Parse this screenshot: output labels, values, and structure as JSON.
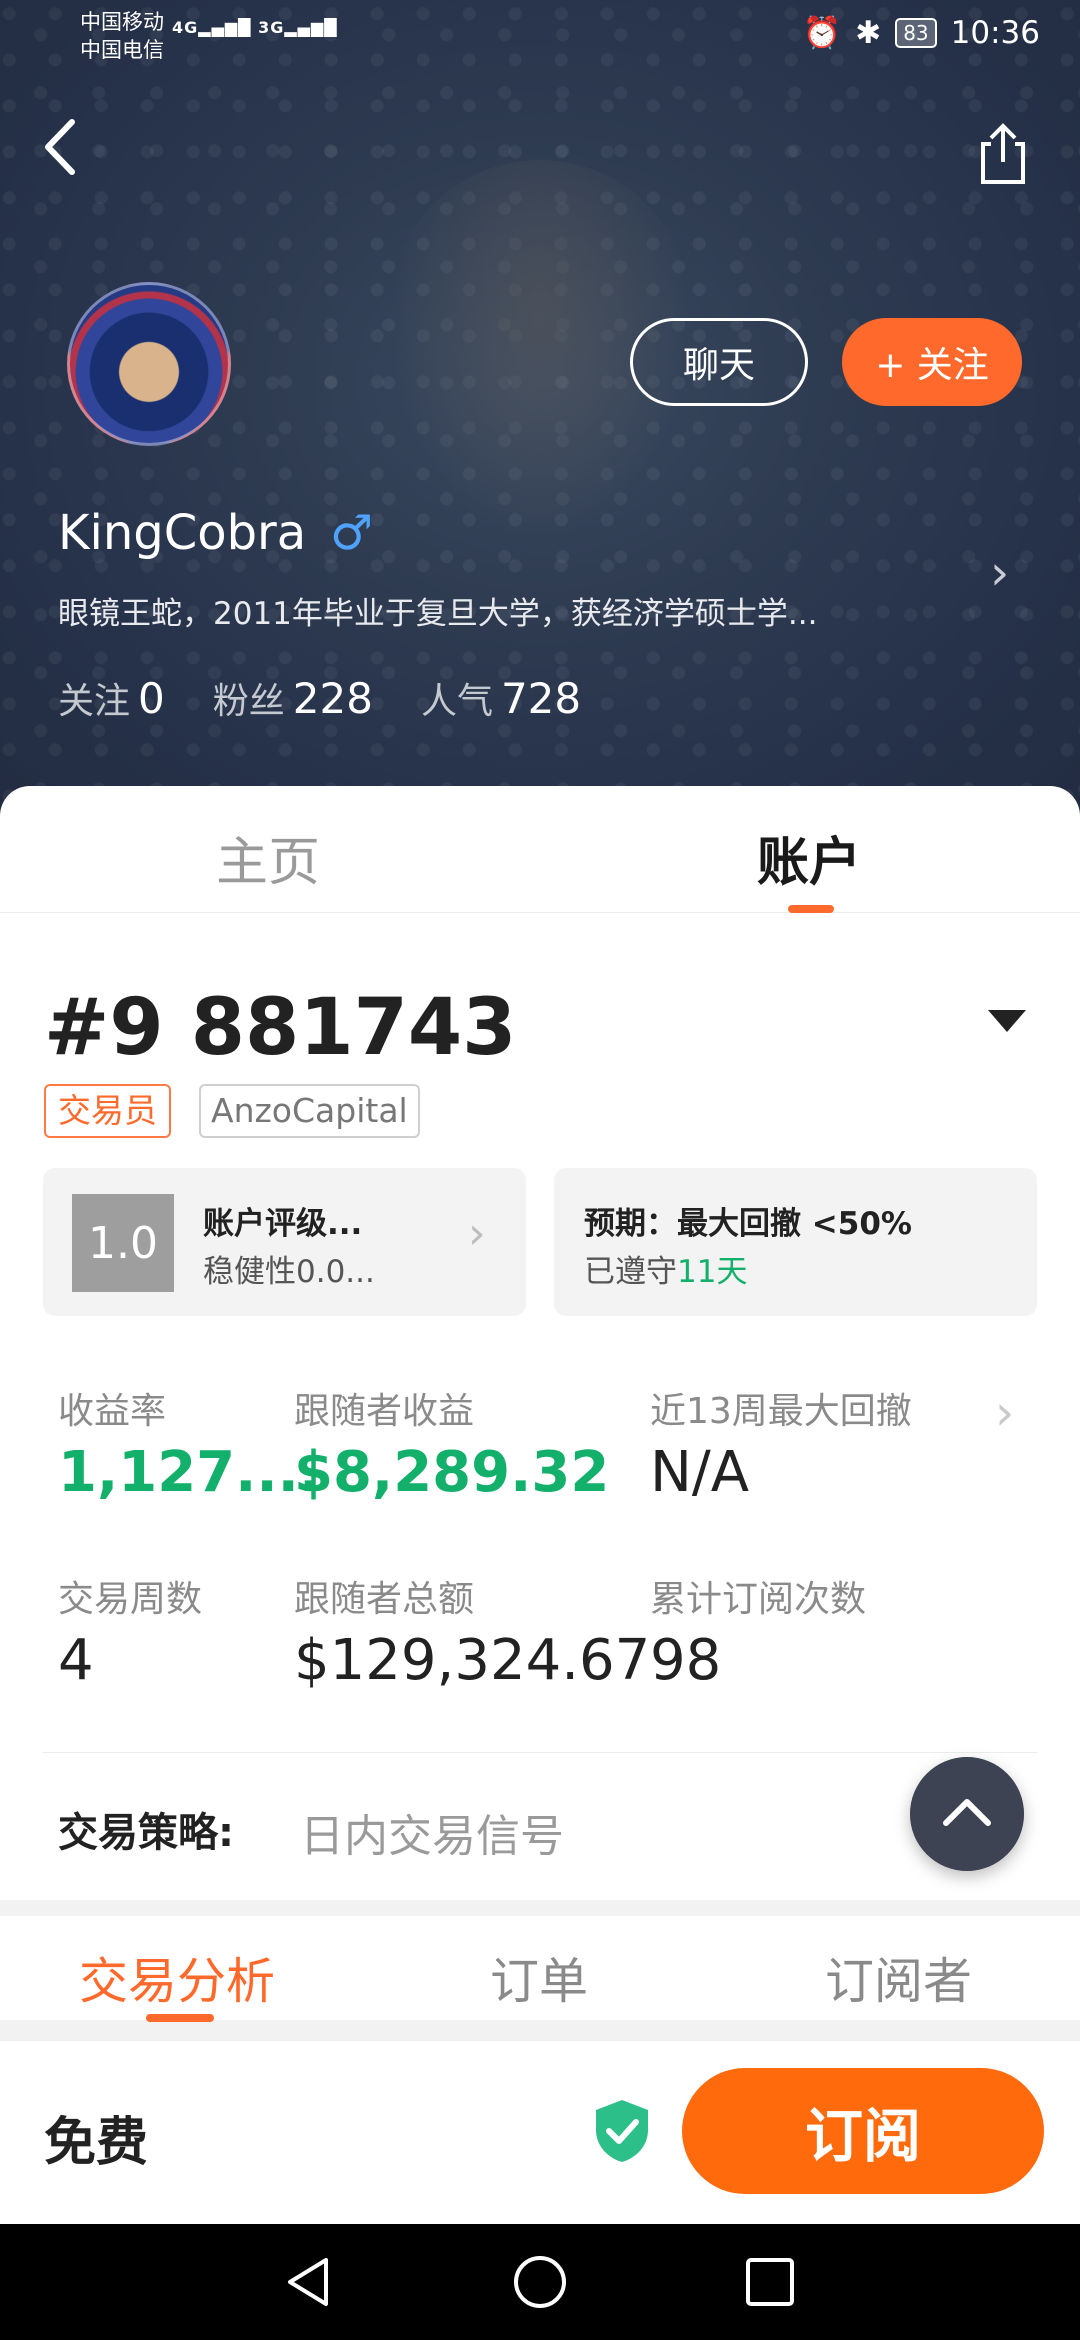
{
  "status_bar": {
    "carrier1": "中国移动",
    "carrier2": "中国电信",
    "net1": "4G",
    "net2": "3G",
    "battery": "83",
    "time": "10:36"
  },
  "profile": {
    "name": "KingCobra",
    "gender_symbol": "♂",
    "bio": "眼镜王蛇，2011年毕业于复旦大学，获经济学硕士学...",
    "chat_label": "聊天",
    "follow_label": "+ 关注",
    "stats": [
      {
        "label": "关注",
        "value": "0"
      },
      {
        "label": "粉丝",
        "value": "228"
      },
      {
        "label": "人气",
        "value": "728"
      }
    ]
  },
  "tabs": [
    "主页",
    "账户"
  ],
  "active_tab": "账户",
  "account": {
    "number": "#9 881743",
    "tag_role": "交易员",
    "tag_broker": "AnzoCapital",
    "rating_score": "1.0",
    "rating_title": "账户评级...",
    "rating_sub": "稳健性0.0...",
    "expect_title": "预期：最大回撤 <50%",
    "expect_sub_prefix": "已遵守",
    "expect_sub_days": "11天"
  },
  "metrics": [
    {
      "label": "收益率",
      "value": "1,127...."
    },
    {
      "label": "跟随者收益",
      "value": "$8,289.32"
    },
    {
      "label": "近13周最大回撤",
      "value": "N/A"
    },
    {
      "label": "交易周数",
      "value": "4"
    },
    {
      "label": "跟随者总额",
      "value": "$129,324.67"
    },
    {
      "label": "累计订阅次数",
      "value": "98"
    }
  ],
  "strategy": {
    "label": "交易策略:",
    "value": "日内交易信号"
  },
  "sub_tabs": [
    "交易分析",
    "订单",
    "订阅者"
  ],
  "bottom": {
    "price": "免费",
    "subscribe_label": "订阅"
  },
  "colors": {
    "accent": "#ff6a2c",
    "positive": "#13b06b",
    "hero_bg": "#2d3a50"
  },
  "icons": [
    "back-icon",
    "share-icon",
    "chevron-right-icon",
    "dropdown-caret-icon",
    "scroll-top-icon",
    "shield-check-icon",
    "nav-back-icon",
    "nav-home-icon",
    "nav-recent-icon"
  ]
}
